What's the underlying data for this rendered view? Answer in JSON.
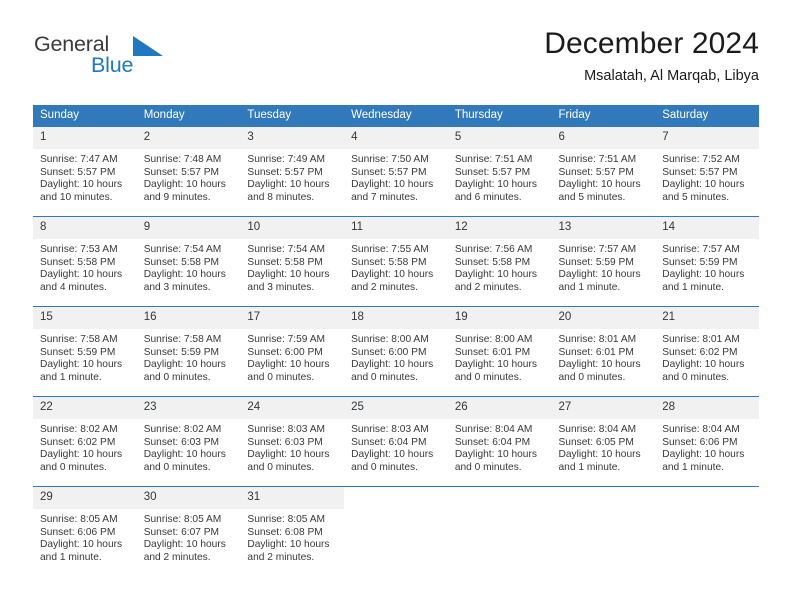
{
  "brand": {
    "name_part1": "General",
    "name_part2": "Blue",
    "triangle_icon": "brand-triangle-icon",
    "color_dark": "#3b3b3b",
    "color_blue": "#1f78c1"
  },
  "header": {
    "title": "December 2024",
    "subtitle": "Msalatah, Al Marqab, Libya"
  },
  "theme": {
    "header_blue": "#3179ba",
    "daynum_band": "#f1f1f1",
    "text": "#3a3a3a"
  },
  "weekdays": [
    "Sunday",
    "Monday",
    "Tuesday",
    "Wednesday",
    "Thursday",
    "Friday",
    "Saturday"
  ],
  "labels": {
    "sunrise_prefix": "Sunrise: ",
    "sunset_prefix": "Sunset: ",
    "daylight_prefix": "Daylight: "
  },
  "weeks": [
    [
      {
        "day": "1",
        "sunrise": "Sunrise: 7:47 AM",
        "sunset": "Sunset: 5:57 PM",
        "daylight_line1": "Daylight: 10 hours",
        "daylight_line2": "and 10 minutes."
      },
      {
        "day": "2",
        "sunrise": "Sunrise: 7:48 AM",
        "sunset": "Sunset: 5:57 PM",
        "daylight_line1": "Daylight: 10 hours",
        "daylight_line2": "and 9 minutes."
      },
      {
        "day": "3",
        "sunrise": "Sunrise: 7:49 AM",
        "sunset": "Sunset: 5:57 PM",
        "daylight_line1": "Daylight: 10 hours",
        "daylight_line2": "and 8 minutes."
      },
      {
        "day": "4",
        "sunrise": "Sunrise: 7:50 AM",
        "sunset": "Sunset: 5:57 PM",
        "daylight_line1": "Daylight: 10 hours",
        "daylight_line2": "and 7 minutes."
      },
      {
        "day": "5",
        "sunrise": "Sunrise: 7:51 AM",
        "sunset": "Sunset: 5:57 PM",
        "daylight_line1": "Daylight: 10 hours",
        "daylight_line2": "and 6 minutes."
      },
      {
        "day": "6",
        "sunrise": "Sunrise: 7:51 AM",
        "sunset": "Sunset: 5:57 PM",
        "daylight_line1": "Daylight: 10 hours",
        "daylight_line2": "and 5 minutes."
      },
      {
        "day": "7",
        "sunrise": "Sunrise: 7:52 AM",
        "sunset": "Sunset: 5:57 PM",
        "daylight_line1": "Daylight: 10 hours",
        "daylight_line2": "and 5 minutes."
      }
    ],
    [
      {
        "day": "8",
        "sunrise": "Sunrise: 7:53 AM",
        "sunset": "Sunset: 5:58 PM",
        "daylight_line1": "Daylight: 10 hours",
        "daylight_line2": "and 4 minutes."
      },
      {
        "day": "9",
        "sunrise": "Sunrise: 7:54 AM",
        "sunset": "Sunset: 5:58 PM",
        "daylight_line1": "Daylight: 10 hours",
        "daylight_line2": "and 3 minutes."
      },
      {
        "day": "10",
        "sunrise": "Sunrise: 7:54 AM",
        "sunset": "Sunset: 5:58 PM",
        "daylight_line1": "Daylight: 10 hours",
        "daylight_line2": "and 3 minutes."
      },
      {
        "day": "11",
        "sunrise": "Sunrise: 7:55 AM",
        "sunset": "Sunset: 5:58 PM",
        "daylight_line1": "Daylight: 10 hours",
        "daylight_line2": "and 2 minutes."
      },
      {
        "day": "12",
        "sunrise": "Sunrise: 7:56 AM",
        "sunset": "Sunset: 5:58 PM",
        "daylight_line1": "Daylight: 10 hours",
        "daylight_line2": "and 2 minutes."
      },
      {
        "day": "13",
        "sunrise": "Sunrise: 7:57 AM",
        "sunset": "Sunset: 5:59 PM",
        "daylight_line1": "Daylight: 10 hours",
        "daylight_line2": "and 1 minute."
      },
      {
        "day": "14",
        "sunrise": "Sunrise: 7:57 AM",
        "sunset": "Sunset: 5:59 PM",
        "daylight_line1": "Daylight: 10 hours",
        "daylight_line2": "and 1 minute."
      }
    ],
    [
      {
        "day": "15",
        "sunrise": "Sunrise: 7:58 AM",
        "sunset": "Sunset: 5:59 PM",
        "daylight_line1": "Daylight: 10 hours",
        "daylight_line2": "and 1 minute."
      },
      {
        "day": "16",
        "sunrise": "Sunrise: 7:58 AM",
        "sunset": "Sunset: 5:59 PM",
        "daylight_line1": "Daylight: 10 hours",
        "daylight_line2": "and 0 minutes."
      },
      {
        "day": "17",
        "sunrise": "Sunrise: 7:59 AM",
        "sunset": "Sunset: 6:00 PM",
        "daylight_line1": "Daylight: 10 hours",
        "daylight_line2": "and 0 minutes."
      },
      {
        "day": "18",
        "sunrise": "Sunrise: 8:00 AM",
        "sunset": "Sunset: 6:00 PM",
        "daylight_line1": "Daylight: 10 hours",
        "daylight_line2": "and 0 minutes."
      },
      {
        "day": "19",
        "sunrise": "Sunrise: 8:00 AM",
        "sunset": "Sunset: 6:01 PM",
        "daylight_line1": "Daylight: 10 hours",
        "daylight_line2": "and 0 minutes."
      },
      {
        "day": "20",
        "sunrise": "Sunrise: 8:01 AM",
        "sunset": "Sunset: 6:01 PM",
        "daylight_line1": "Daylight: 10 hours",
        "daylight_line2": "and 0 minutes."
      },
      {
        "day": "21",
        "sunrise": "Sunrise: 8:01 AM",
        "sunset": "Sunset: 6:02 PM",
        "daylight_line1": "Daylight: 10 hours",
        "daylight_line2": "and 0 minutes."
      }
    ],
    [
      {
        "day": "22",
        "sunrise": "Sunrise: 8:02 AM",
        "sunset": "Sunset: 6:02 PM",
        "daylight_line1": "Daylight: 10 hours",
        "daylight_line2": "and 0 minutes."
      },
      {
        "day": "23",
        "sunrise": "Sunrise: 8:02 AM",
        "sunset": "Sunset: 6:03 PM",
        "daylight_line1": "Daylight: 10 hours",
        "daylight_line2": "and 0 minutes."
      },
      {
        "day": "24",
        "sunrise": "Sunrise: 8:03 AM",
        "sunset": "Sunset: 6:03 PM",
        "daylight_line1": "Daylight: 10 hours",
        "daylight_line2": "and 0 minutes."
      },
      {
        "day": "25",
        "sunrise": "Sunrise: 8:03 AM",
        "sunset": "Sunset: 6:04 PM",
        "daylight_line1": "Daylight: 10 hours",
        "daylight_line2": "and 0 minutes."
      },
      {
        "day": "26",
        "sunrise": "Sunrise: 8:04 AM",
        "sunset": "Sunset: 6:04 PM",
        "daylight_line1": "Daylight: 10 hours",
        "daylight_line2": "and 0 minutes."
      },
      {
        "day": "27",
        "sunrise": "Sunrise: 8:04 AM",
        "sunset": "Sunset: 6:05 PM",
        "daylight_line1": "Daylight: 10 hours",
        "daylight_line2": "and 1 minute."
      },
      {
        "day": "28",
        "sunrise": "Sunrise: 8:04 AM",
        "sunset": "Sunset: 6:06 PM",
        "daylight_line1": "Daylight: 10 hours",
        "daylight_line2": "and 1 minute."
      }
    ],
    [
      {
        "day": "29",
        "sunrise": "Sunrise: 8:05 AM",
        "sunset": "Sunset: 6:06 PM",
        "daylight_line1": "Daylight: 10 hours",
        "daylight_line2": "and 1 minute."
      },
      {
        "day": "30",
        "sunrise": "Sunrise: 8:05 AM",
        "sunset": "Sunset: 6:07 PM",
        "daylight_line1": "Daylight: 10 hours",
        "daylight_line2": "and 2 minutes."
      },
      {
        "day": "31",
        "sunrise": "Sunrise: 8:05 AM",
        "sunset": "Sunset: 6:08 PM",
        "daylight_line1": "Daylight: 10 hours",
        "daylight_line2": "and 2 minutes."
      },
      {
        "day": "",
        "sunrise": "",
        "sunset": "",
        "daylight_line1": "",
        "daylight_line2": ""
      },
      {
        "day": "",
        "sunrise": "",
        "sunset": "",
        "daylight_line1": "",
        "daylight_line2": ""
      },
      {
        "day": "",
        "sunrise": "",
        "sunset": "",
        "daylight_line1": "",
        "daylight_line2": ""
      },
      {
        "day": "",
        "sunrise": "",
        "sunset": "",
        "daylight_line1": "",
        "daylight_line2": ""
      }
    ]
  ]
}
